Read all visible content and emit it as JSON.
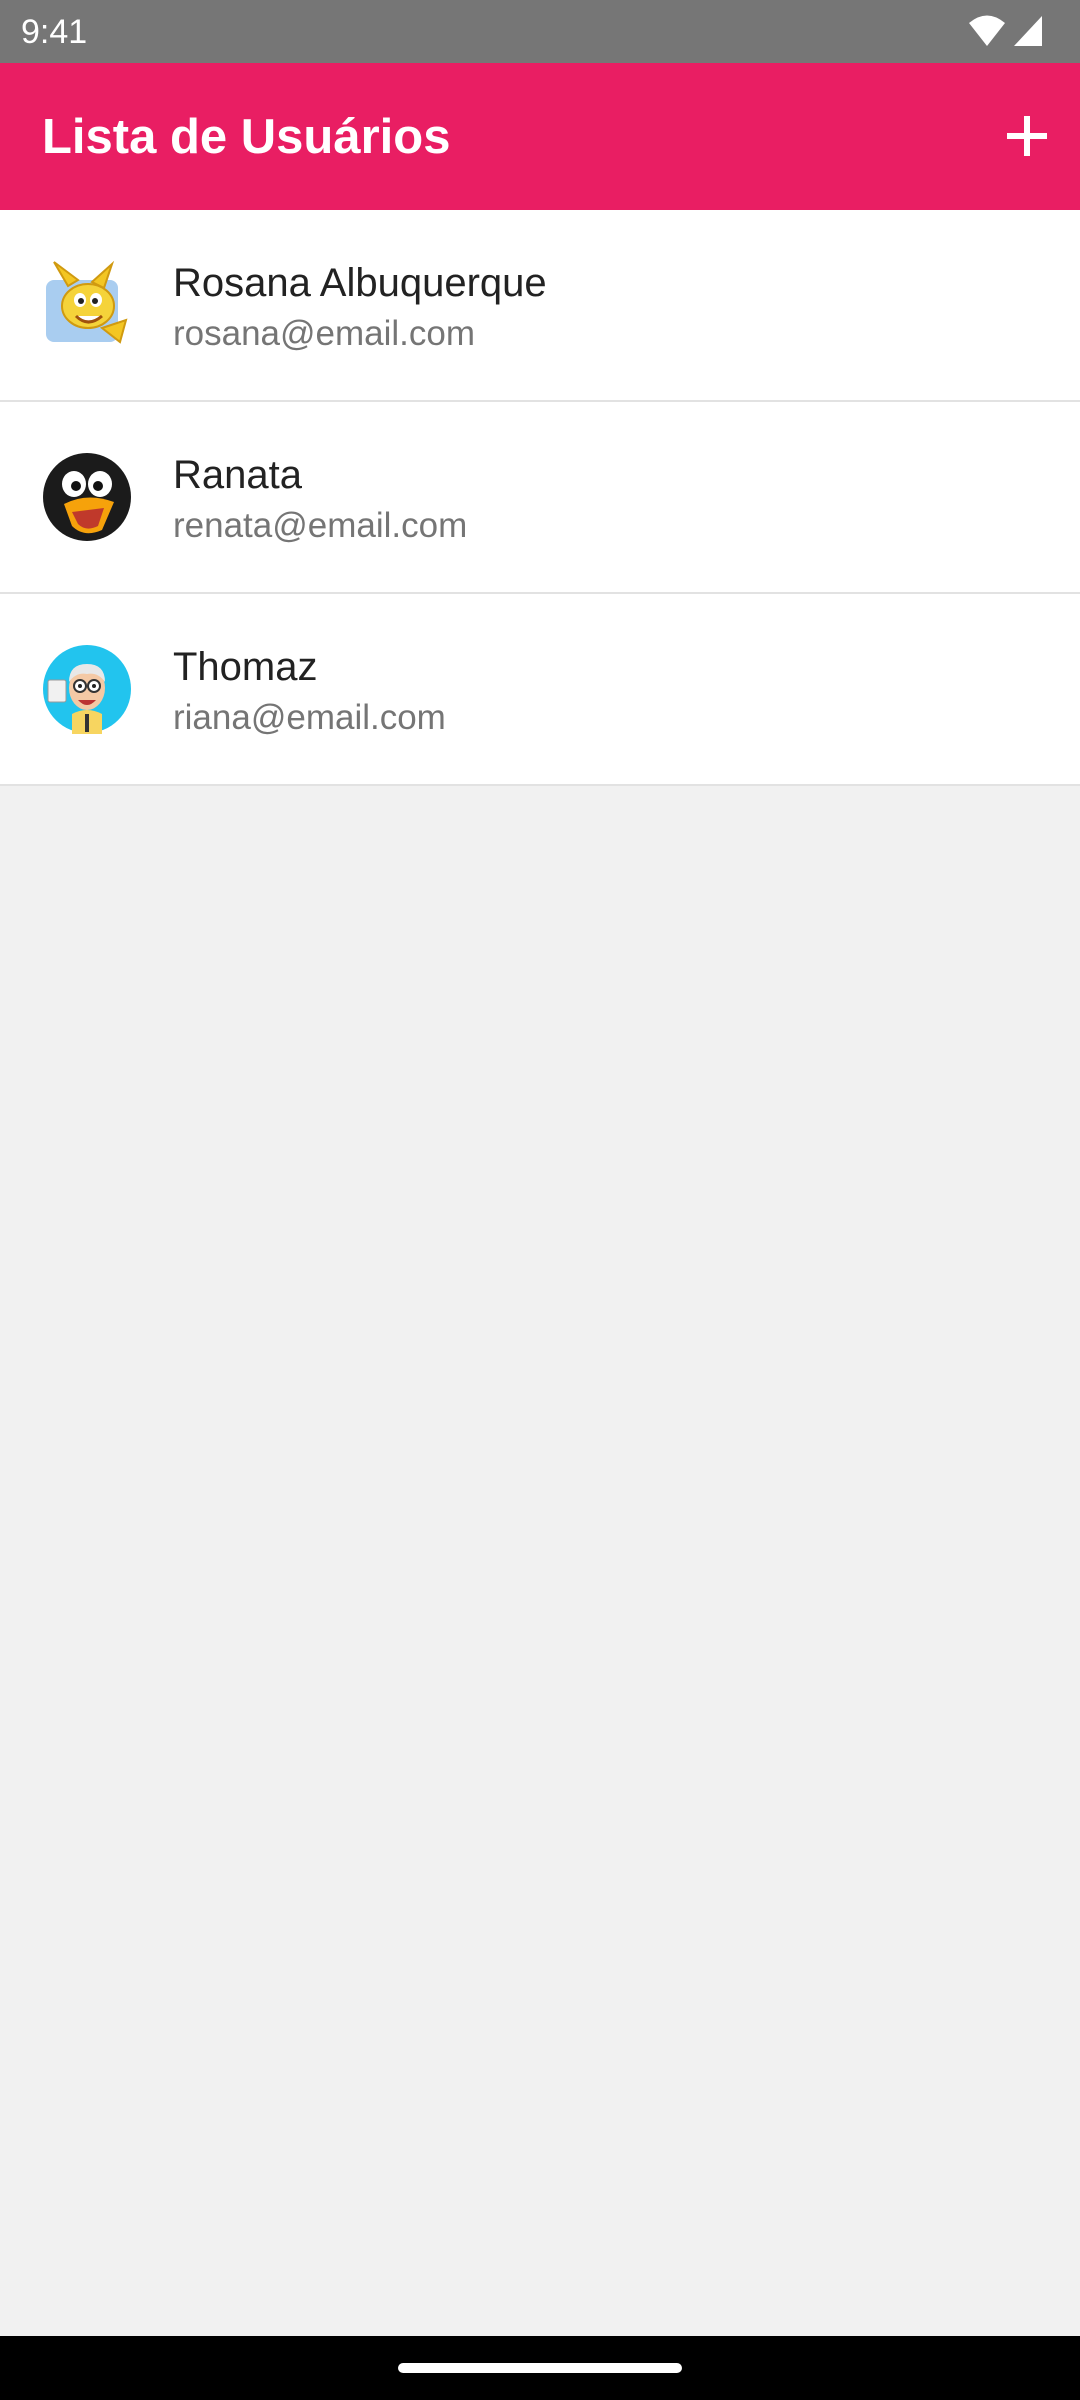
{
  "status_bar": {
    "time": "9:41",
    "icons": [
      "wifi-icon",
      "signal-icon"
    ]
  },
  "app_bar": {
    "title": "Lista de Usuários",
    "add_icon": "plus-icon",
    "color": "#e91e63"
  },
  "users": [
    {
      "name": "Rosana Albuquerque",
      "email": "rosana@email.com",
      "avatar": "rabbit-avatar"
    },
    {
      "name": "Ranata",
      "email": "renata@email.com",
      "avatar": "penguin-avatar"
    },
    {
      "name": "Thomaz",
      "email": "riana@email.com",
      "avatar": "professor-avatar"
    }
  ]
}
